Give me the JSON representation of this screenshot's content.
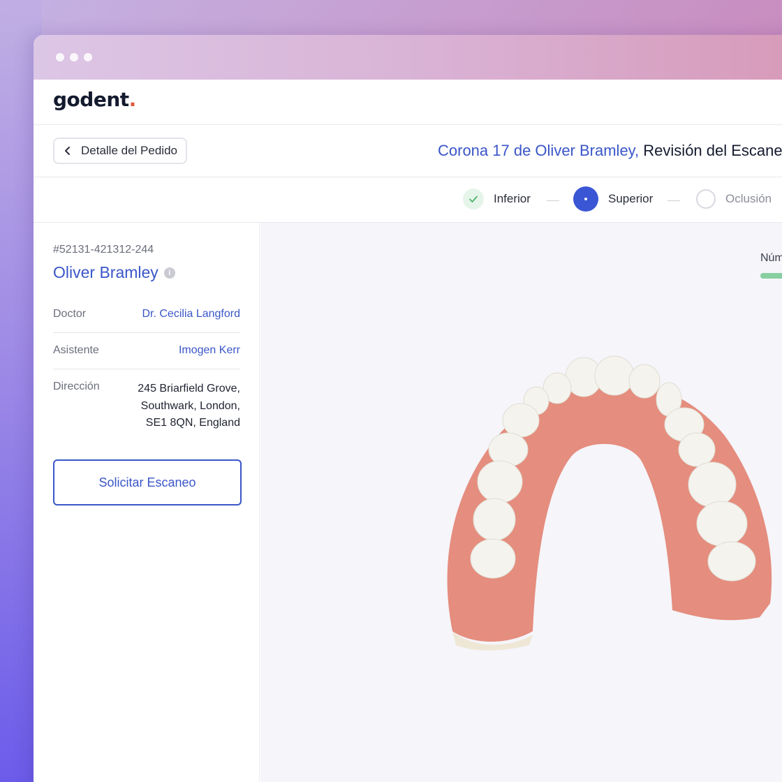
{
  "window": {
    "dots": 3
  },
  "logo": {
    "text": "godent",
    "dot": "."
  },
  "header": {
    "back_label": "Detalle del Pedido",
    "title_accent": "Corona 17 de Oliver Bramley,",
    "title_rest": "Revisión del Escaneo"
  },
  "stepper": {
    "steps": [
      {
        "label": "Inferior",
        "state": "done"
      },
      {
        "label": "Superior",
        "state": "active"
      },
      {
        "label": "Oclusión",
        "state": "todo"
      }
    ]
  },
  "sidebar": {
    "order_id": "#52131-421312-244",
    "patient_name": "Oliver Bramley",
    "info_icon": "i",
    "rows": [
      {
        "label": "Doctor",
        "value": "Dr. Cecilia Langford"
      },
      {
        "label": "Asistente",
        "value": "Imogen Kerr"
      },
      {
        "label": "Dirección",
        "value_lines": [
          "245 Briarfield Grove,",
          "Southwark, London,",
          "SE1 8QN, England"
        ]
      }
    ],
    "request_button": "Solicitar Escaneo"
  },
  "viewer": {
    "number_label": "Núm"
  },
  "colors": {
    "accent": "#3a56c8",
    "active_step": "#3a56d4",
    "success": "#4cb56a",
    "logo_dot": "#e0553a",
    "gum": "#e58d7e",
    "tooth": "#f4f3ee"
  },
  "icons": {
    "back": "chevron-left-icon",
    "done_step": "check-icon",
    "info": "info-icon"
  }
}
